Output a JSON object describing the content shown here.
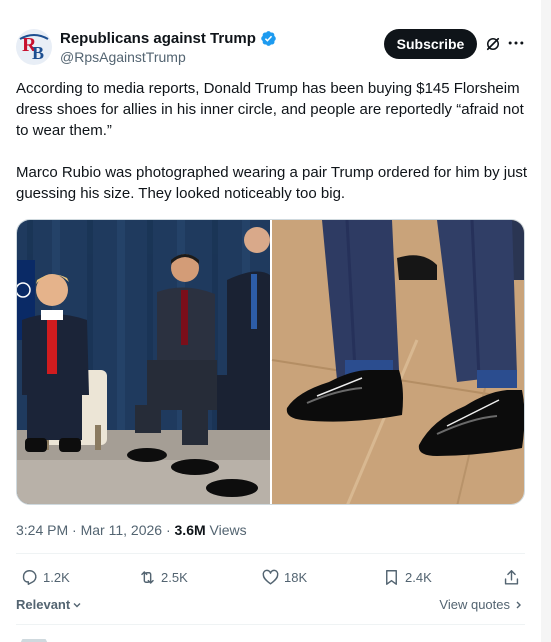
{
  "author": {
    "display_name": "Republicans against Trump",
    "handle": "@RpsAgainstTrump",
    "avatar_text": "RB",
    "verified": true
  },
  "header_actions": {
    "subscribe_label": "Subscribe",
    "grok_icon": "grok-icon",
    "more_icon": "more-icon"
  },
  "post": {
    "paragraph_1": "According to media reports, Donald Trump has been buying $145 Florsheim dress shoes for allies in his inner circle, and people are reportedly “afraid not to wear them.”",
    "paragraph_2": "Marco Rubio was photographed wearing a pair Trump ordered for him by just guessing his size. They looked noticeably too big."
  },
  "meta": {
    "time": "3:24 PM",
    "sep": " · ",
    "date": "Mar 11, 2026",
    "views_count": "3.6M",
    "views_label": " Views"
  },
  "actions": {
    "replies": "1.2K",
    "reposts": "2.5K",
    "likes": "18K",
    "bookmarks": "2.4K"
  },
  "footer": {
    "sort_label": "Relevant",
    "view_quotes_label": "View quotes"
  },
  "colors": {
    "text_primary": "#0f1419",
    "text_secondary": "#536471",
    "verified_blue": "#1d9bf0",
    "divider": "#eff3f4"
  }
}
